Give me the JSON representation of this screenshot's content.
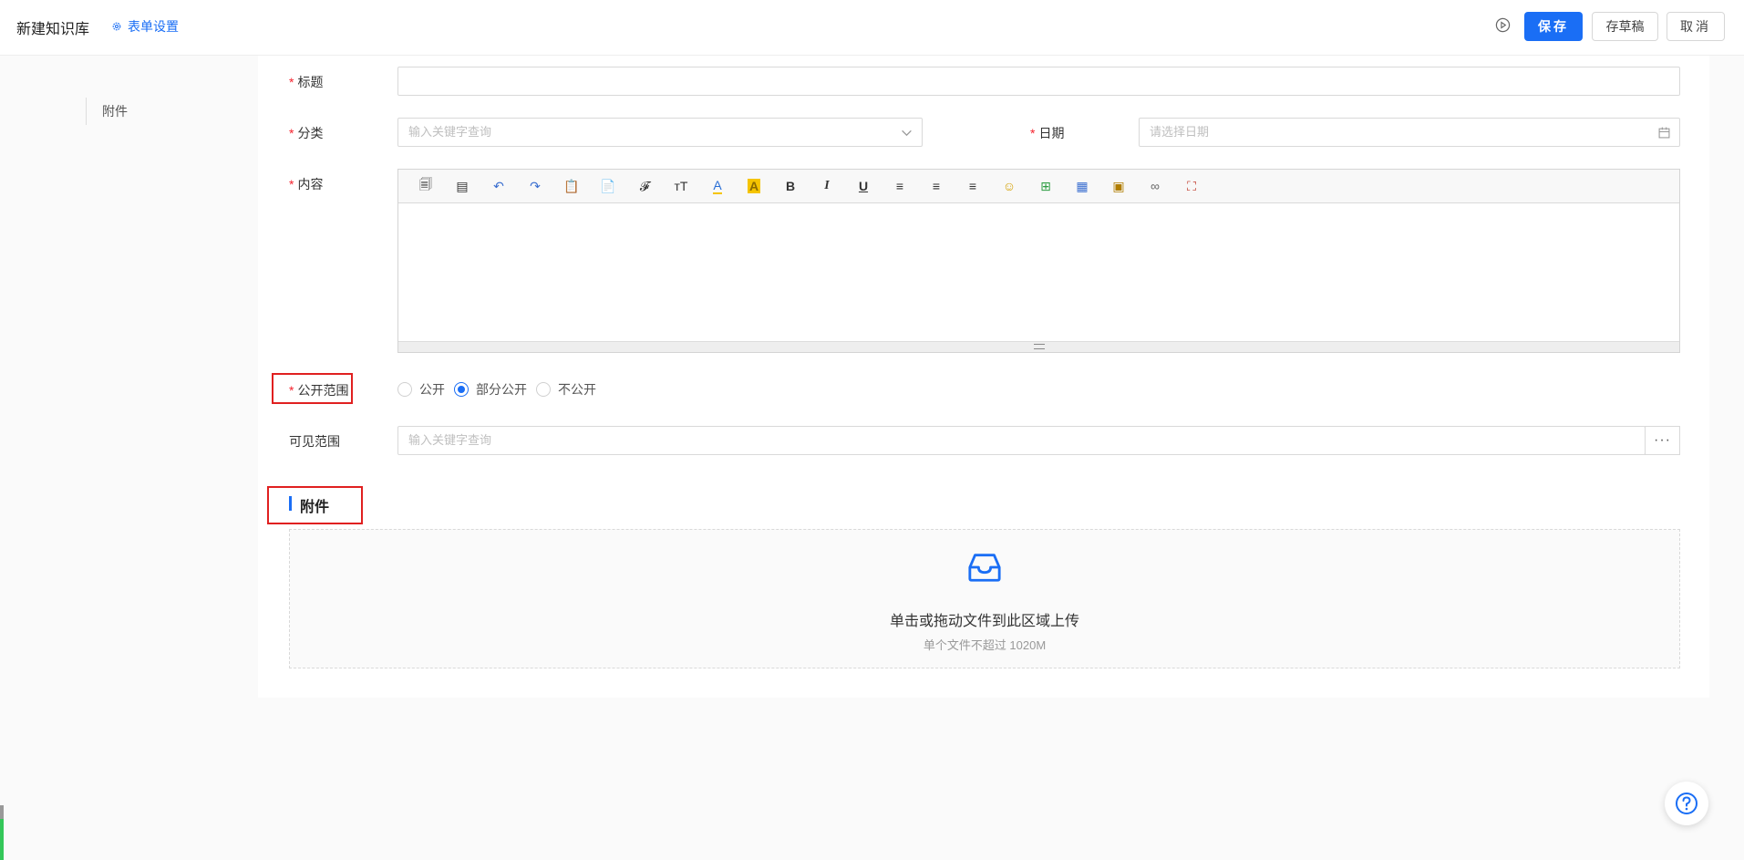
{
  "header": {
    "title": "新建知识库",
    "form_settings": "表单设置",
    "save": "保存",
    "draft": "存草稿",
    "cancel": "取消"
  },
  "side_nav": {
    "items": [
      {
        "label": "附件"
      }
    ]
  },
  "form": {
    "required_mark": "*",
    "title": {
      "label": "标题",
      "value": ""
    },
    "category": {
      "label": "分类",
      "placeholder": "输入关键字查询"
    },
    "date": {
      "label": "日期",
      "placeholder": "请选择日期"
    },
    "content": {
      "label": "内容"
    },
    "scope": {
      "label": "公开范围",
      "options": [
        "公开",
        "部分公开",
        "不公开"
      ],
      "selected": "部分公开"
    },
    "visible": {
      "label": "可见范围",
      "placeholder": "输入关键字查询",
      "more": "···"
    }
  },
  "editor_toolbar": [
    {
      "name": "new-doc-icon",
      "glyph": "🗐"
    },
    {
      "name": "template-icon",
      "glyph": "▤"
    },
    {
      "name": "undo-icon",
      "glyph": "↶"
    },
    {
      "name": "redo-icon",
      "glyph": "↷"
    },
    {
      "name": "paste-icon",
      "glyph": "📋"
    },
    {
      "name": "paste-text-icon",
      "glyph": "📄"
    },
    {
      "name": "font-family-icon",
      "glyph": "𝓕"
    },
    {
      "name": "font-size-icon",
      "glyph": "ᴛT"
    },
    {
      "name": "font-color-icon",
      "glyph": "A"
    },
    {
      "name": "background-color-icon",
      "glyph": "A"
    },
    {
      "name": "bold-icon",
      "glyph": "B"
    },
    {
      "name": "italic-icon",
      "glyph": "I"
    },
    {
      "name": "underline-icon",
      "glyph": "U"
    },
    {
      "name": "align-left-icon",
      "glyph": "≡"
    },
    {
      "name": "align-center-icon",
      "glyph": "≡"
    },
    {
      "name": "align-right-icon",
      "glyph": "≡"
    },
    {
      "name": "emoji-icon",
      "glyph": "☺"
    },
    {
      "name": "insert-line-icon",
      "glyph": "⊞"
    },
    {
      "name": "table-icon",
      "glyph": "▦"
    },
    {
      "name": "image-icon",
      "glyph": "▣"
    },
    {
      "name": "link-icon",
      "glyph": "∞"
    },
    {
      "name": "fullscreen-icon",
      "glyph": "⛶"
    }
  ],
  "attachments": {
    "section_title": "附件",
    "upload_text": "单击或拖动文件到此区域上传",
    "upload_hint": "单个文件不超过 1020M"
  },
  "colors": {
    "primary": "#1a6ef5",
    "required": "#f5222d",
    "highlight": "#e02020"
  }
}
